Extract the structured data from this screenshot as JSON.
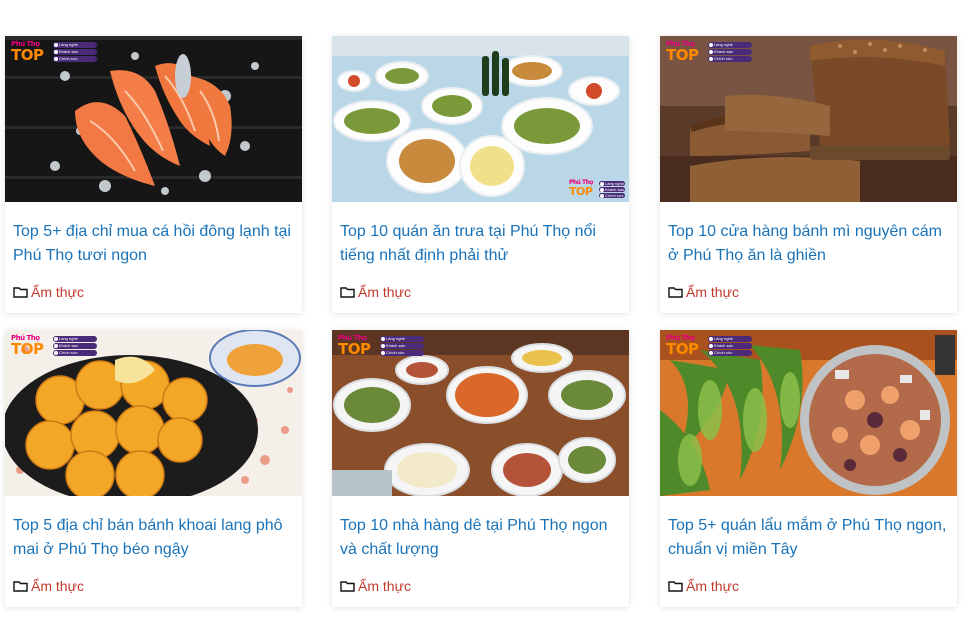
{
  "cards": [
    {
      "title": "Top 5+ địa chỉ mua cá hồi đông lạnh tại Phú Thọ tươi ngon",
      "category": "Ẩm thực",
      "image": "salmon-on-ice"
    },
    {
      "title": "Top 10 quán ăn trưa tại Phú Thọ nổi tiếng nhất định phải thử",
      "category": "Ẩm thực",
      "image": "lunch-table-dishes"
    },
    {
      "title": "Top 10 cửa hàng bánh mì nguyên cám ở Phú Thọ ăn là ghiền",
      "category": "Ẩm thực",
      "image": "whole-grain-bread"
    },
    {
      "title": "Top 5 địa chỉ bán bánh khoai lang phô mai ở Phú Thọ béo ngậy",
      "category": "Ẩm thực",
      "image": "sweet-potato-cheese-balls"
    },
    {
      "title": "Top 10 nhà hàng dê tại Phú Thọ ngon và chất lượng",
      "category": "Ẩm thực",
      "image": "goat-hotpot-table"
    },
    {
      "title": "Top 5+ quán lẩu mắm ở Phú Thọ ngon, chuẩn vị miền Tây",
      "category": "Ẩm thực",
      "image": "fermented-fish-hotpot"
    }
  ],
  "badge": {
    "logo_small": "Phú Thọ",
    "logo_big": "TOP",
    "pills": [
      "Làng nghề",
      "Khách sạn",
      "Chính sức"
    ]
  },
  "colors": {
    "title": "#1a73b8",
    "category": "#c0392b",
    "badge_logo": "#ff8a00"
  },
  "icons": {
    "category": "folder-icon"
  }
}
